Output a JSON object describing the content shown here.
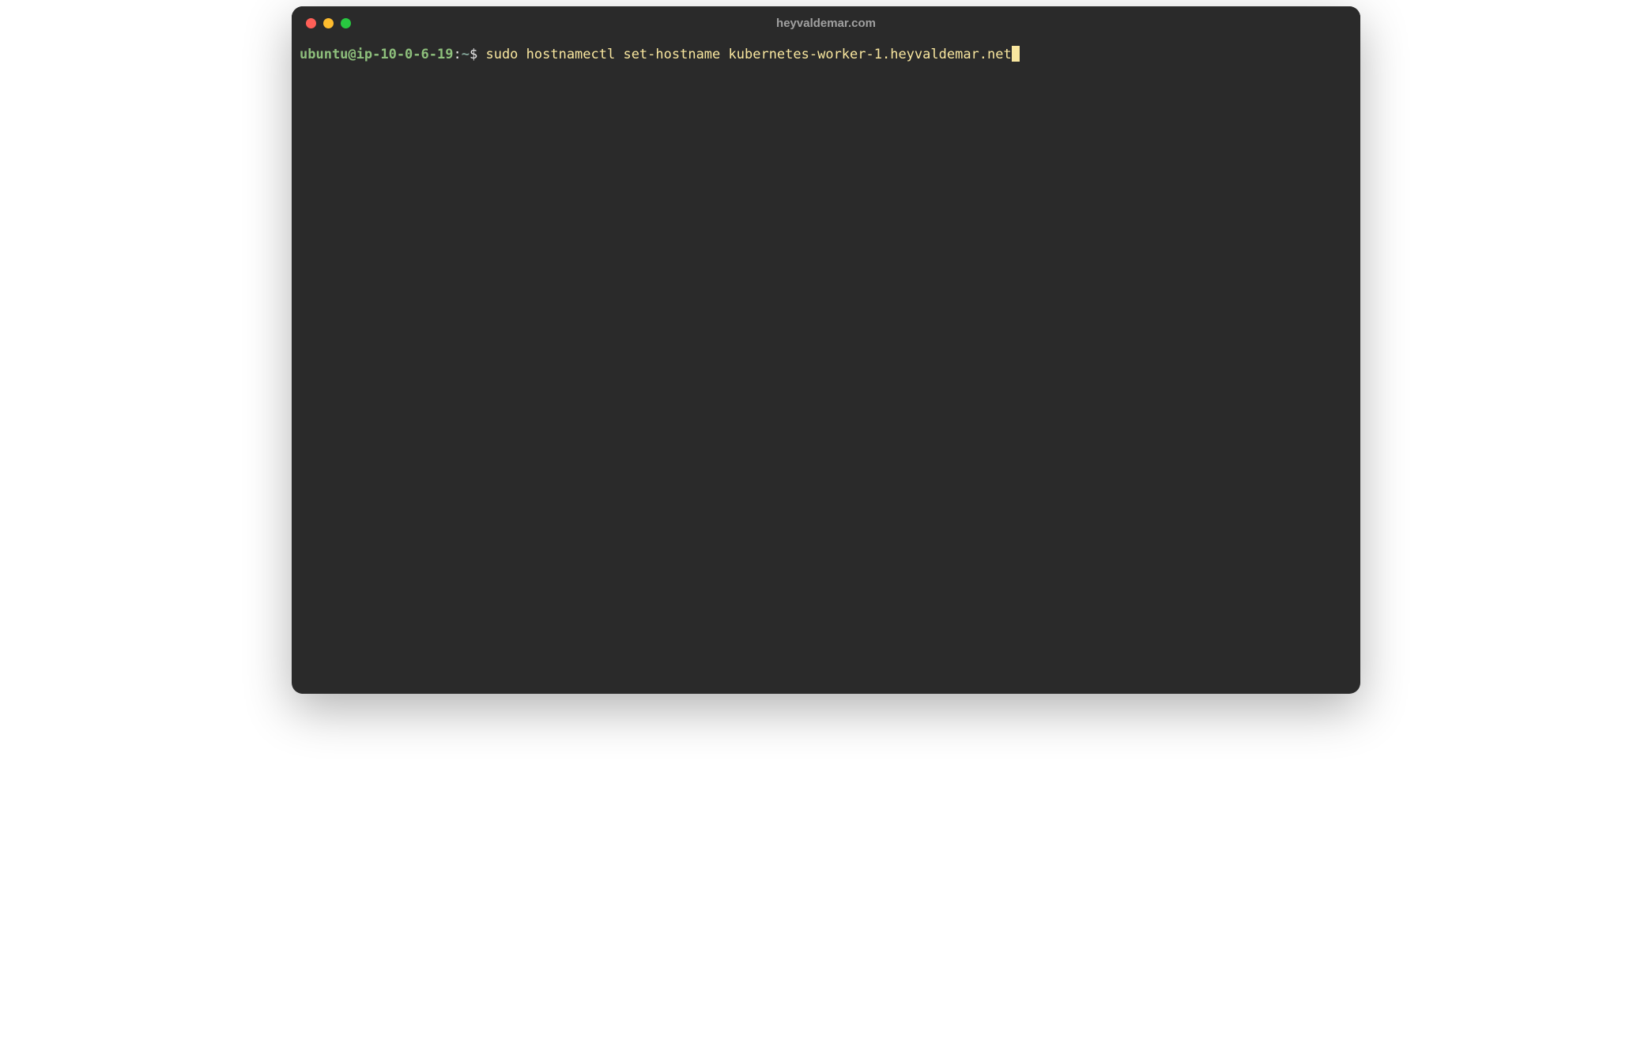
{
  "window": {
    "title": "heyvaldemar.com"
  },
  "terminal": {
    "prompt_user": "ubuntu@ip-10-0-6-19",
    "prompt_sep": ":",
    "prompt_path": "~",
    "prompt_symbol": "$",
    "command": "sudo hostnamectl set-hostname kubernetes-worker-1.heyvaldemar.net"
  }
}
